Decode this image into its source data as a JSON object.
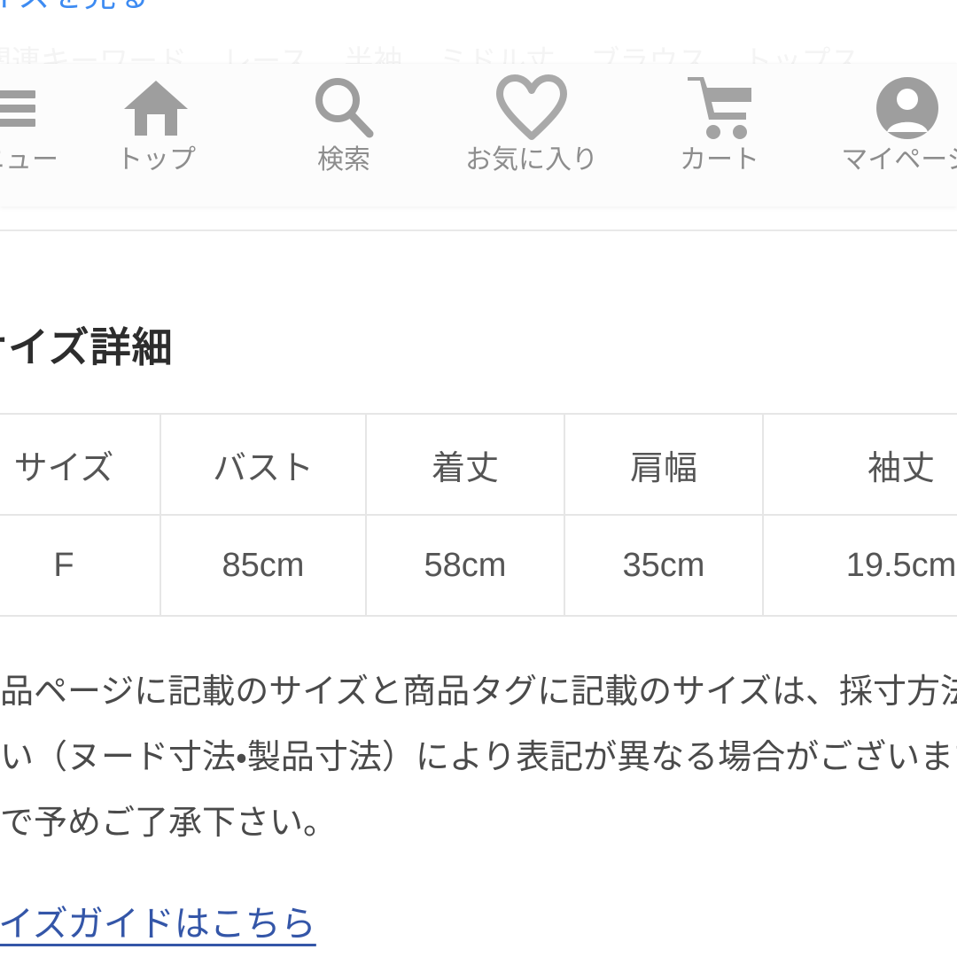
{
  "top_link": {
    "label": "サイズを見る",
    "color": "#3d8bf2"
  },
  "faded_keywords": {
    "label": "関連キーワード",
    "items": [
      "レース",
      "半袖",
      "ミドル丈",
      "ブラウス",
      "トップス"
    ]
  },
  "navbar": {
    "items": [
      {
        "label": "メニュー",
        "icon": "hamburger-menu-icon"
      },
      {
        "label": "トップ",
        "icon": "home-icon"
      },
      {
        "label": "検索",
        "icon": "search-icon"
      },
      {
        "label": "お気に入り",
        "icon": "heart-outline-icon"
      },
      {
        "label": "カート",
        "icon": "shopping-cart-icon"
      },
      {
        "label": "マイページ",
        "icon": "person-account-icon"
      }
    ],
    "icon_color": "#9e9e9e",
    "label_color": "#8d8d8d"
  },
  "section": {
    "heading": "サイズ詳細"
  },
  "size_table": {
    "headers": [
      "サイズ",
      "バスト",
      "着丈",
      "肩幅",
      "袖丈"
    ],
    "rows": [
      [
        "F",
        "85cm",
        "58cm",
        "35cm",
        "19.5cm"
      ]
    ],
    "border_color": "#e6e6e6"
  },
  "disclaimer": {
    "lines": [
      "商品ページに記載のサイズと商品タグに記載のサイズは、採寸方法の",
      "違い（ヌード寸法・製品寸法）により表記が異なる場合がございます",
      "ので予めご了承下さい。"
    ]
  },
  "size_guide": {
    "label": "サイズガイドはこちら",
    "color": "#3456a8"
  }
}
